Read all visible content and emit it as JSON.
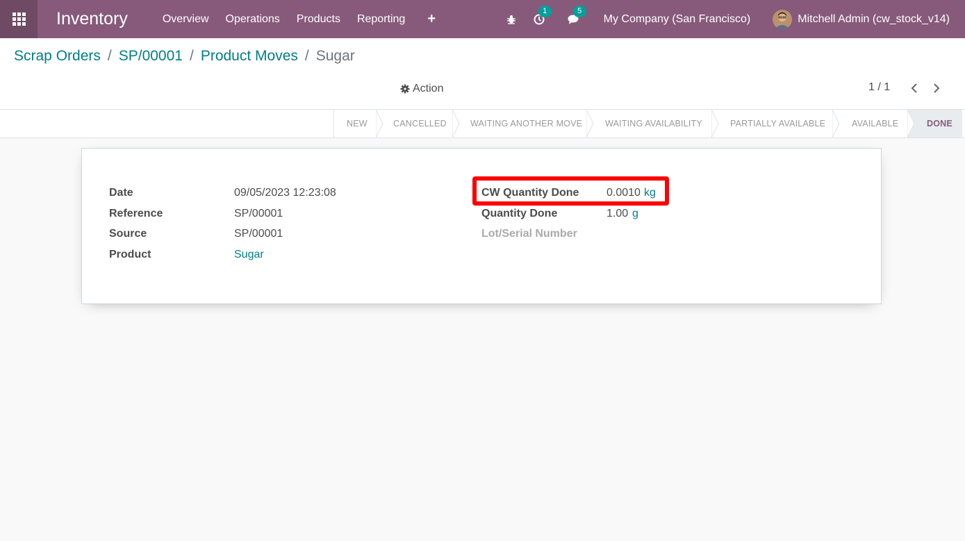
{
  "navbar": {
    "app_title": "Inventory",
    "menu": [
      "Overview",
      "Operations",
      "Products",
      "Reporting"
    ],
    "activity_badge": "1",
    "messages_badge": "5",
    "company": "My Company (San Francisco)",
    "user": "Mitchell Admin (cw_stock_v14)"
  },
  "breadcrumb": {
    "items": [
      "Scrap Orders",
      "SP/00001",
      "Product Moves"
    ],
    "active": "Sugar"
  },
  "actions": {
    "action_label": "Action"
  },
  "pager": {
    "text": "1 / 1"
  },
  "status_stages": [
    "New",
    "Cancelled",
    "Waiting Another Move",
    "Waiting Availability",
    "Partially Available",
    "Available",
    "Done"
  ],
  "status_current": "Done",
  "form": {
    "left": {
      "date_label": "Date",
      "date_value": "09/05/2023 12:23:08",
      "reference_label": "Reference",
      "reference_value": "SP/00001",
      "source_label": "Source",
      "source_value": "SP/00001",
      "product_label": "Product",
      "product_value": "Sugar"
    },
    "right": {
      "cw_qty_label": "CW Quantity Done",
      "cw_qty_value": "0.0010",
      "cw_qty_uom": "kg",
      "qty_label": "Quantity Done",
      "qty_value": "1.00",
      "qty_uom": "g",
      "lot_label": "Lot/Serial Number"
    }
  },
  "colors": {
    "brand": "#875a7b",
    "link": "#017e84",
    "highlight": "#ff0000",
    "badge": "#00a09d"
  }
}
